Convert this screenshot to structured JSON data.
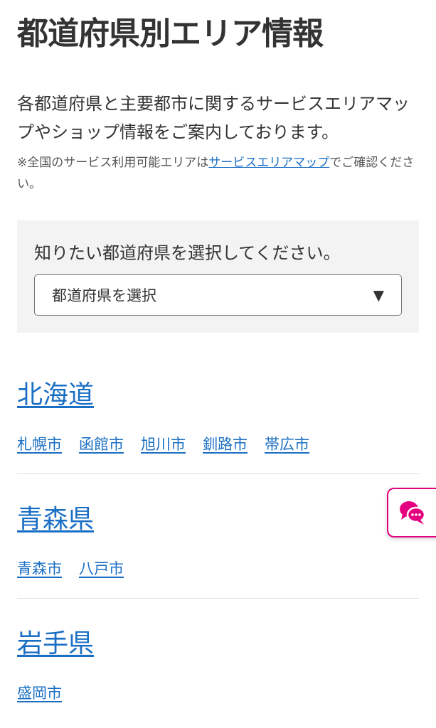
{
  "page": {
    "title": "都道府県別エリア情報",
    "lead": "各都道府県と主要都市に関するサービスエリアマップやショップ情報をご案内しております。",
    "note_prefix": "※全国のサービス利用可能エリアは",
    "note_link": "サービスエリアマップ",
    "note_suffix": "でご確認ください。"
  },
  "selector": {
    "label": "知りたい都道府県を選択してください。",
    "selected": "都道府県を選択",
    "arrow": "▼"
  },
  "prefectures": [
    {
      "name": "北海道",
      "cities": [
        "札幌市",
        "函館市",
        "旭川市",
        "釧路市",
        "帯広市"
      ]
    },
    {
      "name": "青森県",
      "cities": [
        "青森市",
        "八戸市"
      ]
    },
    {
      "name": "岩手県",
      "cities": [
        "盛岡市"
      ]
    }
  ],
  "colors": {
    "link": "#1a6fc4",
    "chat_accent": "#e5007f"
  },
  "icons": {
    "chat": "chat-bubble-icon"
  }
}
